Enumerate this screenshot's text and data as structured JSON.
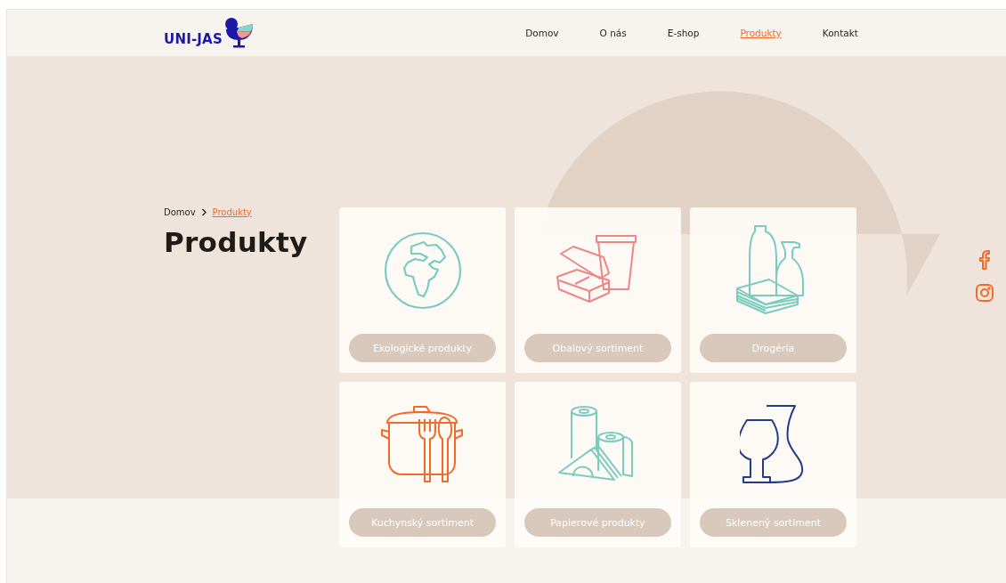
{
  "header": {
    "logo": "UNI-JAS",
    "nav": [
      {
        "label": "Domov",
        "selected": false
      },
      {
        "label": "O nás",
        "selected": false
      },
      {
        "label": "E-shop",
        "selected": false
      },
      {
        "label": "Produkty",
        "selected": true
      },
      {
        "label": "Kontakt",
        "selected": false
      }
    ]
  },
  "breadcrumb": [
    {
      "label": "Domov",
      "selected": false
    },
    {
      "label": "Produkty",
      "selected": true
    }
  ],
  "title": "Produkty",
  "categories": [
    {
      "label": "Ekologické produkty",
      "kind": "globe",
      "color": "#7ccbc0"
    },
    {
      "label": "Obalový sortiment",
      "kind": "packaging",
      "color": "#ef8585"
    },
    {
      "label": "Drogéria",
      "kind": "cleaning",
      "color": "#7ccbc0"
    },
    {
      "label": "Kuchynský sortiment",
      "kind": "cookware",
      "color": "#f26a2a"
    },
    {
      "label": "Papierové produkty",
      "kind": "paper",
      "color": "#7ccbc0"
    },
    {
      "label": "Sklenený sortiment",
      "kind": "glassware",
      "color": "#223a8f"
    }
  ],
  "social": [
    {
      "kind": "facebook"
    },
    {
      "kind": "instagram"
    }
  ]
}
